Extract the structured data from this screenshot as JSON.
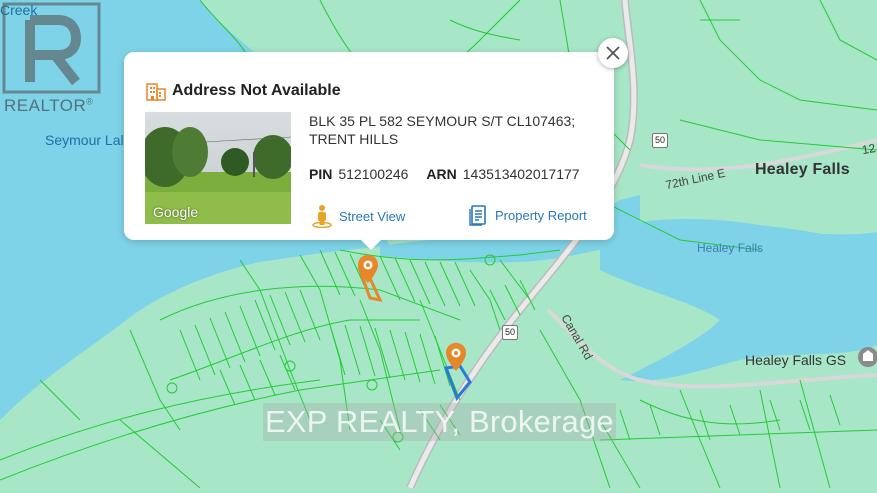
{
  "map": {
    "labels": {
      "creek": "Creek",
      "seymour_lake": "Seymour Lal",
      "healey_falls_town": "Healey Falls",
      "healey_falls_small": "Healey Falls",
      "healey_falls_gs": "Healey Falls GS",
      "line_72": "72th Line E",
      "canal_rd": "Canal Rd",
      "edge_number": "12"
    },
    "shields": {
      "hwy_north": "50",
      "hwy_south": "50"
    },
    "colors": {
      "land": "#a8e6c8",
      "water": "#7fd3e8",
      "parcel_line": "#22cc33",
      "road": "#c8c8c8",
      "pin": "#e8862a",
      "selected_parcel": "#e8862a",
      "other_parcel": "#2a7ad8"
    }
  },
  "branding": {
    "realtor_logo": "REALTOR",
    "registered_mark": "®",
    "watermark": "EXP REALTY, Brokerage"
  },
  "popup": {
    "title": "Address Not Available",
    "title_icon": "building-icon",
    "legal_description": "BLK 35 PL 582 SEYMOUR S/T CL107463; TRENT HILLS",
    "pin_label": "PIN",
    "pin_value": "512100246",
    "arn_label": "ARN",
    "arn_value": "143513402017177",
    "photo_credit": "Google",
    "street_view_label": "Street View",
    "property_report_label": "Property Report",
    "close_icon": "close-icon"
  }
}
